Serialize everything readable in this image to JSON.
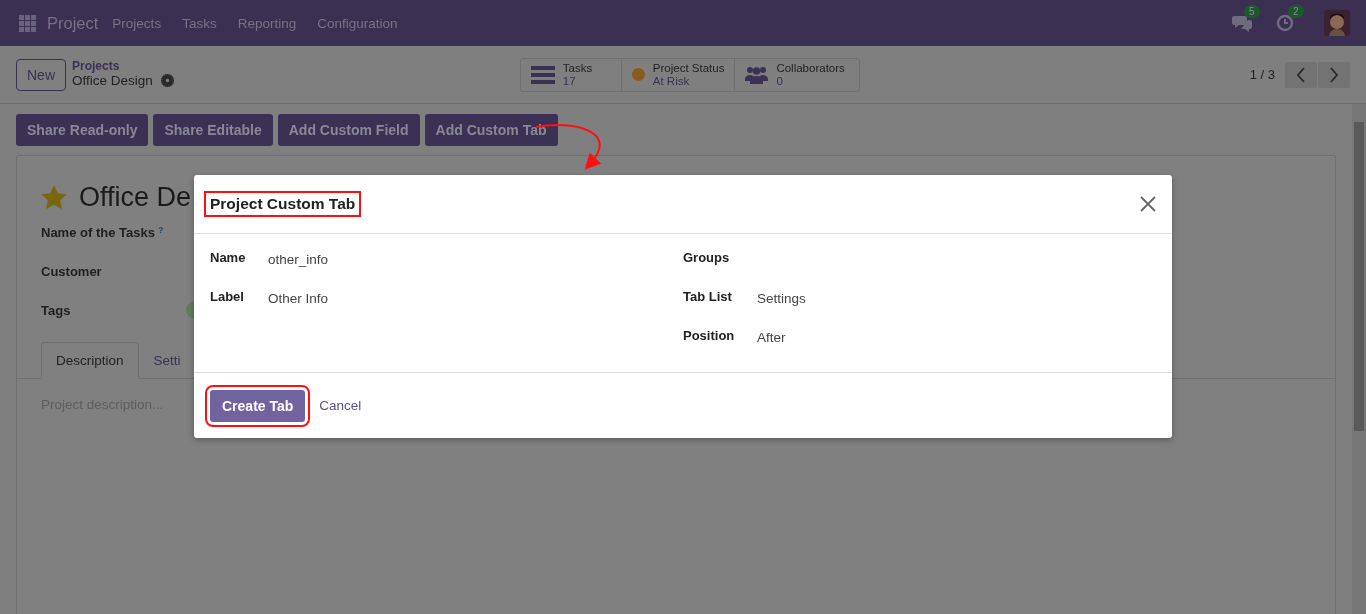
{
  "navbar": {
    "app": "Project",
    "menu": [
      "Projects",
      "Tasks",
      "Reporting",
      "Configuration"
    ],
    "messages_badge": "5",
    "activities_badge": "2"
  },
  "control_panel": {
    "new_button": "New",
    "breadcrumb": "Projects",
    "record": "Office Design",
    "stats": [
      {
        "kind": "tasks",
        "label": "Tasks",
        "value": "17"
      },
      {
        "kind": "status",
        "label": "Project Status",
        "value": "At Risk",
        "color": "#8a5a1e"
      },
      {
        "kind": "collaborators",
        "label": "Collaborators",
        "value": "0"
      }
    ],
    "pager": "1 / 3"
  },
  "actions": [
    "Share Read-only",
    "Share Editable",
    "Add Custom Field",
    "Add Custom Tab"
  ],
  "form": {
    "title": "Office De",
    "starred": true,
    "fields": [
      "Name of the Tasks",
      "Customer",
      "Tags"
    ],
    "help_mark": "?",
    "tabs": [
      {
        "label": "Description",
        "selected": true
      },
      {
        "label": "Setti",
        "selected": false
      }
    ],
    "description_placeholder": "Project description..."
  },
  "dialog": {
    "title": "Project Custom Tab",
    "left": [
      {
        "label": "Name",
        "value": "other_info"
      },
      {
        "label": "Label",
        "value": "Other Info"
      }
    ],
    "right": [
      {
        "label": "Groups"
      },
      {
        "label": "Tab List",
        "value": "Settings"
      },
      {
        "label": "Position",
        "value": "After"
      }
    ],
    "primary": "Create Tab",
    "secondary": "Cancel"
  }
}
